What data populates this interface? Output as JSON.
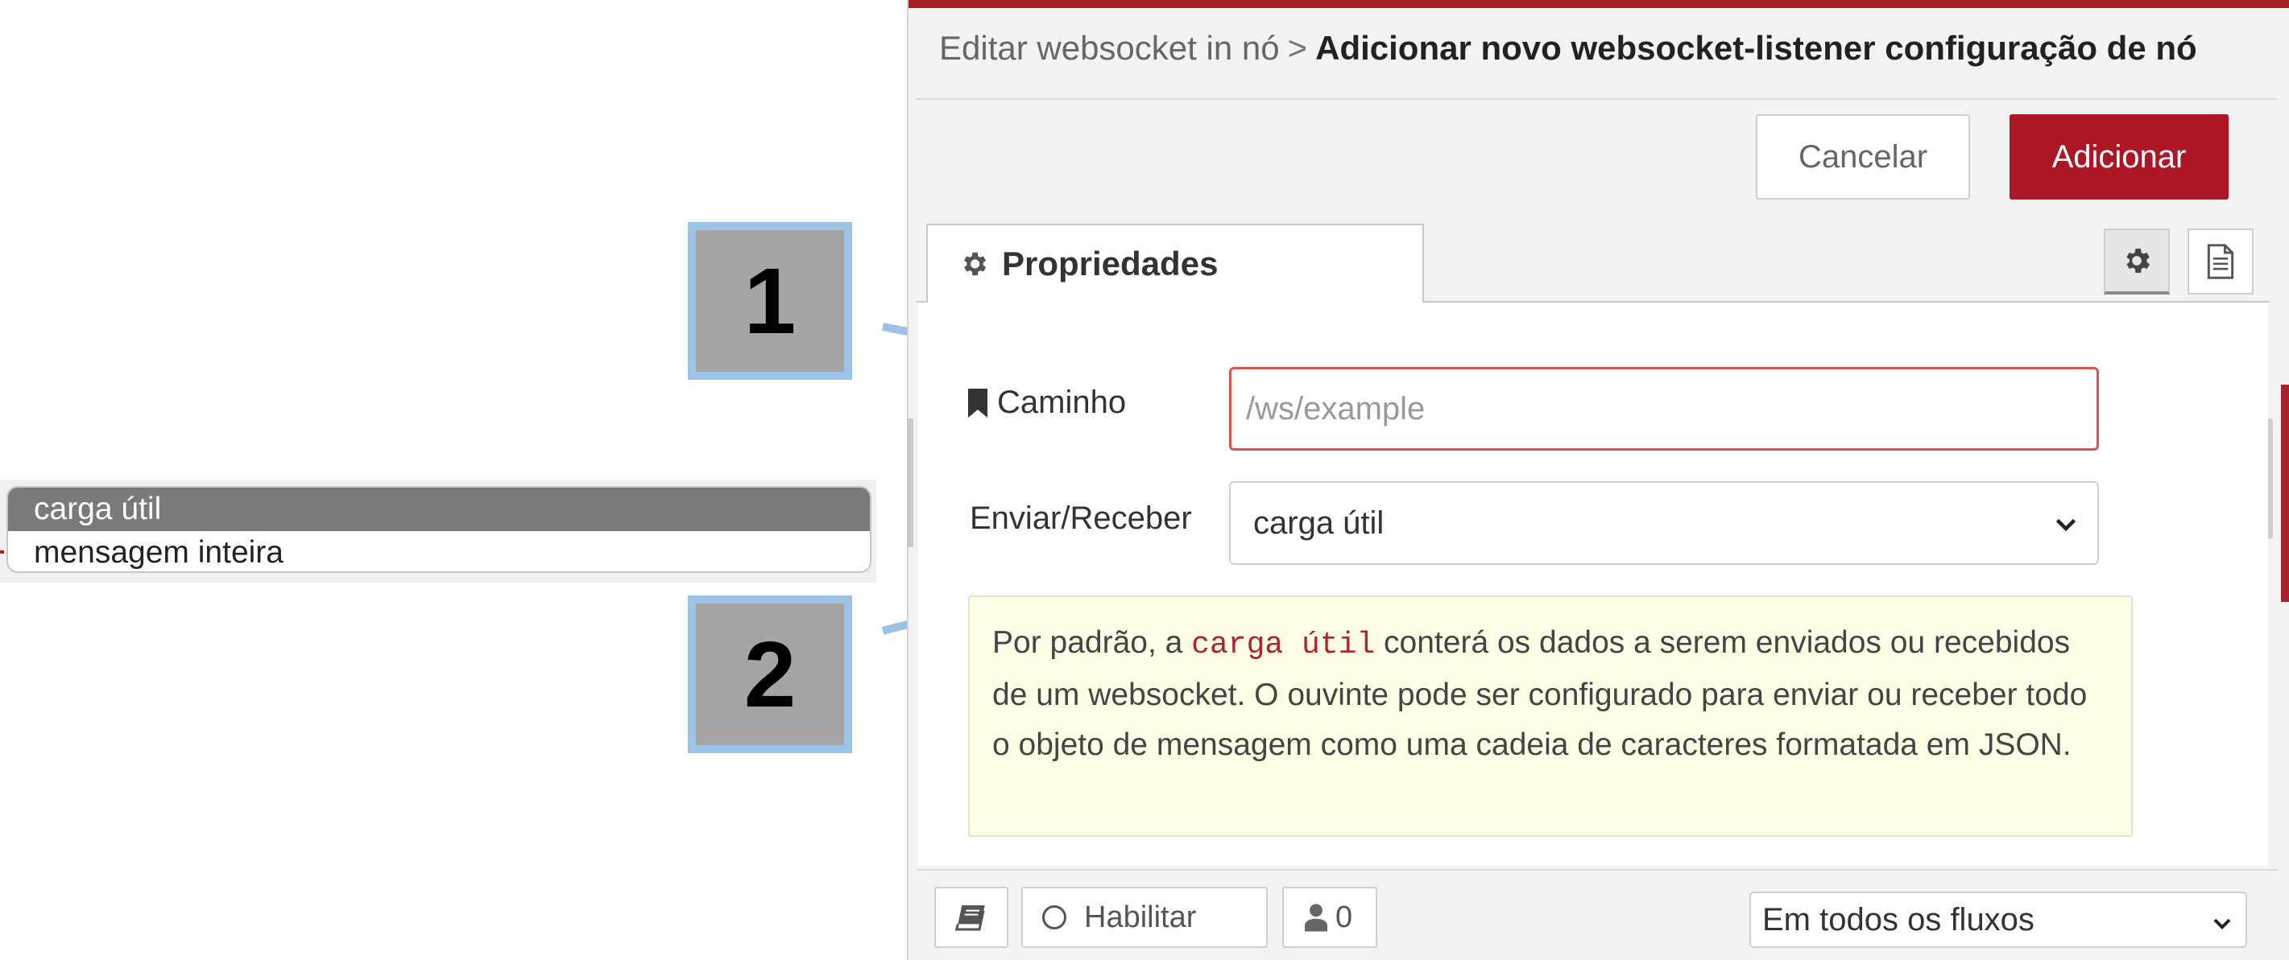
{
  "dropdown": {
    "options": [
      "carga útil",
      "mensagem inteira"
    ],
    "selected_index": 0
  },
  "callouts": [
    "1",
    "2"
  ],
  "dialog": {
    "breadcrumb_parent": "Editar websocket in nó",
    "breadcrumb_separator": ">",
    "breadcrumb_current": "Adicionar novo websocket-listener configuração de nó",
    "cancel_label": "Cancelar",
    "add_label": "Adicionar",
    "accent_color": "#ad1625"
  },
  "tabs": {
    "properties_label": "Propriedades"
  },
  "form": {
    "path_label": "Caminho",
    "path_placeholder": "/ws/example",
    "path_value": "",
    "send_receive_label": "Enviar/Receber",
    "send_receive_value": "carga útil"
  },
  "tip": {
    "part1": "Por padrão, a ",
    "code": "carga útil",
    "part2": " conterá os dados a serem enviados ou recebidos de um websocket. O ouvinte pode ser configurado para enviar ou receber todo o objeto de mensagem como uma cadeia de caracteres formatada em JSON."
  },
  "footer": {
    "enable_label": "Habilitar",
    "users_count": "0",
    "scope_value": "Em todos os fluxos"
  },
  "icons": {
    "tab": "gear-icon",
    "settings": "gear-icon",
    "description": "document-icon",
    "path": "bookmark-icon",
    "docs": "book-icon",
    "enable": "circle-icon",
    "users": "user-icon",
    "select": "chevron-down-icon"
  }
}
